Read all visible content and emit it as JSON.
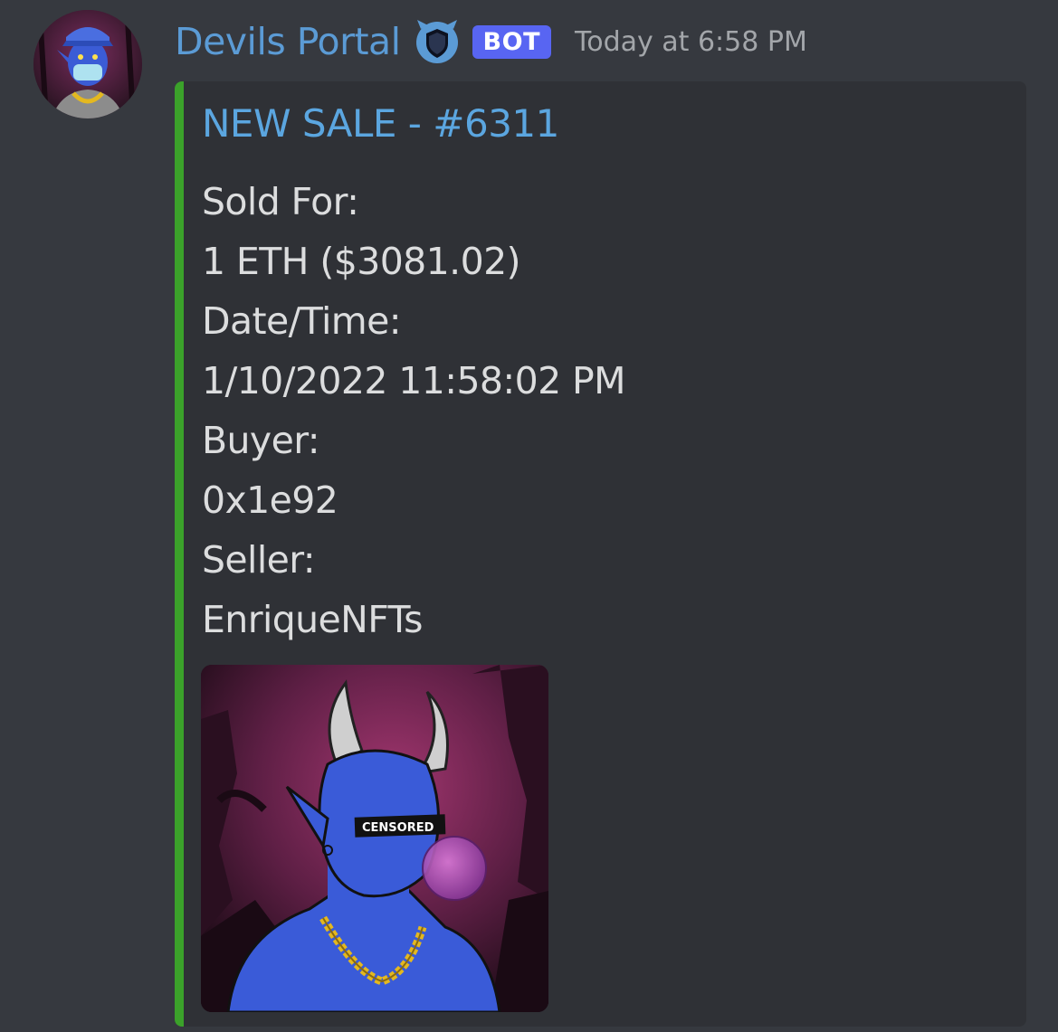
{
  "message": {
    "author": "Devils Portal",
    "bot_tag": "BOT",
    "timestamp": "Today at 6:58 PM",
    "avatar_icon": "devil-avatar",
    "badge_icon": "shield-badge-icon"
  },
  "embed": {
    "accent_color": "#3ba12a",
    "title": "NEW SALE - #6311",
    "lines": [
      "Sold For:",
      "1 ETH ($3081.02)",
      "Date/Time:",
      "1/10/2022 11:58:02 PM",
      "Buyer:",
      "0x1e92",
      "Seller:",
      "EnriqueNFTs"
    ],
    "image": {
      "censor_label": "CENSORED"
    }
  }
}
